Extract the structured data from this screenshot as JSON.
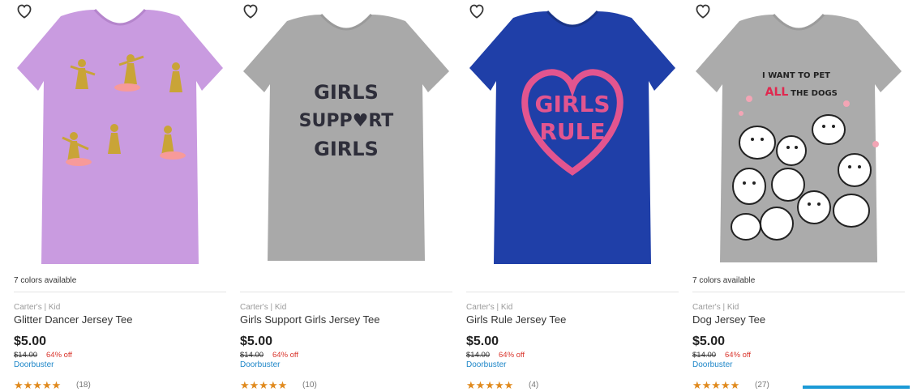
{
  "products": [
    {
      "colors_available": "7 colors available",
      "brand": "Carter's | Kid",
      "name": "Glitter Dancer Jersey Tee",
      "price": "$5.00",
      "original_price": "$14.00",
      "discount": "64% off",
      "badge": "Doorbuster",
      "stars": "★★★★★",
      "reviews": "(18)",
      "shirt_color": "#c99be0",
      "graphic_text": "",
      "icon": "ballerina-graphic"
    },
    {
      "colors_available": "",
      "brand": "Carter's | Kid",
      "name": "Girls Support Girls Jersey Tee",
      "price": "$5.00",
      "original_price": "$14.00",
      "discount": "64% off",
      "badge": "Doorbuster",
      "stars": "★★★★★",
      "reviews": "(10)",
      "shirt_color": "#a9a9a9",
      "graphic_lines": [
        "GIRLS",
        "SUPP♥RT",
        "GIRLS"
      ]
    },
    {
      "colors_available": "",
      "brand": "Carter's | Kid",
      "name": "Girls Rule Jersey Tee",
      "price": "$5.00",
      "original_price": "$14.00",
      "discount": "64% off",
      "badge": "Doorbuster",
      "stars": "★★★★★",
      "reviews": "(4)",
      "shirt_color": "#1f3fa8",
      "graphic_lines": [
        "GIRLS",
        "RULE"
      ]
    },
    {
      "colors_available": "7 colors available",
      "brand": "Carter's | Kid",
      "name": "Dog Jersey Tee",
      "price": "$5.00",
      "original_price": "$14.00",
      "discount": "64% off",
      "badge": "Doorbuster",
      "stars": "★★★★★",
      "reviews": "(27)",
      "shirt_color": "#ababab",
      "graphic_lines": [
        "I WANT TO PET",
        "ALL",
        "THE DOGS"
      ]
    }
  ],
  "icons": {
    "favorite": "heart-outline-icon"
  },
  "colors": {
    "price_red": "#d9342b",
    "link_blue": "#1d86c8",
    "star_orange": "#e08a1e"
  }
}
